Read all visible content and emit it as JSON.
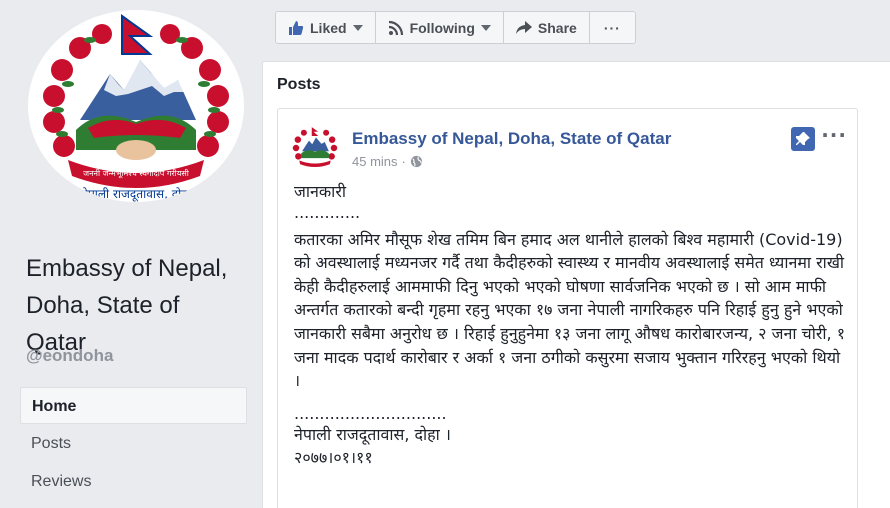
{
  "page": {
    "name": "Embassy of Nepal, Doha, State of Qatar",
    "handle": "@eondoha",
    "logo_motto": "जननी जन्मभूमिश्च स्वर्गादपि गरीयसी",
    "logo_caption": "नेपाली राजदूतावास, दोहा"
  },
  "nav": {
    "items": [
      {
        "label": "Home",
        "active": true
      },
      {
        "label": "Posts",
        "active": false
      },
      {
        "label": "Reviews",
        "active": false
      }
    ]
  },
  "action_bar": {
    "liked_label": "Liked",
    "following_label": "Following",
    "share_label": "Share",
    "more_label": "···"
  },
  "main": {
    "posts_header": "Posts"
  },
  "post": {
    "author": "Embassy of Nepal, Doha, State of Qatar",
    "time": "45 mins",
    "more_label": "···",
    "body": {
      "l1": "जानकारी",
      "l2": ".............",
      "para": "कतारका अमिर मौसूफ शेख तमिम बिन हमाद अल थानीले हालको बिश्व महामारी (Covid-19) को अवस्थालाई मध्यनजर गर्दै तथा कैदीहरुको स्वास्थ्य र मानवीय अवस्थालाई समेत ध्यानमा राखी केही कैदीहरुलाई आममाफी दिनु भएको भएको घोषणा सार्वजनिक भएको छ । सो आम माफी अन्तर्गत कतारको बन्दी गृहमा रहनु भएका १७ जना नेपाली नागरिकहरु पनि रिहाई हुनु हुने भएको जानकारी सबैमा अनुरोध छ । रिहाई हुनुहुनेमा १३ जना लागू औषध कारोबारजन्य, २ जना चोरी, १ जना मादक पदार्थ कारोबार र अर्का १ जना ठगीको कसुरमा सजाय भुक्तान गरिरहनु भएको थियो ।",
      "sep": "..............................",
      "sig": "नेपाली राजदूतावास, दोहा ।",
      "date": "२०७७।०१।११"
    }
  },
  "colors": {
    "link": "#365899",
    "accent": "#4267b2",
    "bg": "#e9ebee"
  }
}
